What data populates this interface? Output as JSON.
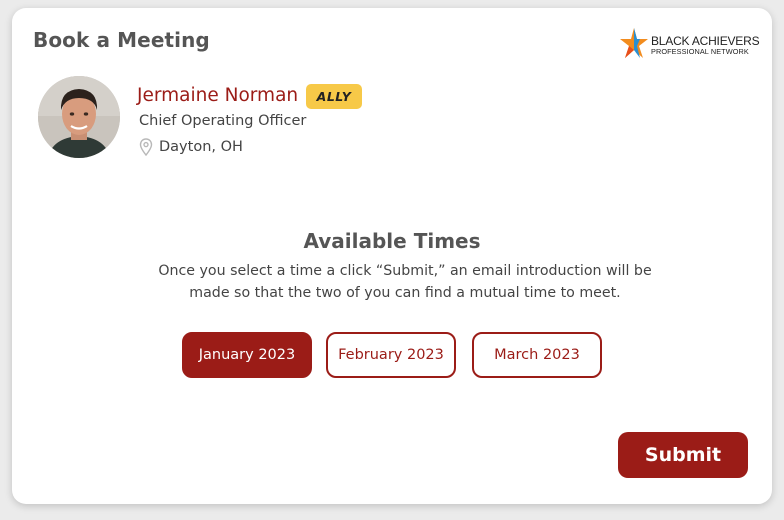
{
  "header": {
    "title": "Book a Meeting",
    "logo": {
      "line1": "BLACK ACHIEVERS",
      "line2": "PROFESSIONAL NETWORK"
    }
  },
  "profile": {
    "name": "Jermaine Norman",
    "badge": "ALLY",
    "role": "Chief Operating Officer",
    "location": "Dayton, OH"
  },
  "availability": {
    "title": "Available Times",
    "description": "Once you select a time a click “Submit,” an email introduction will be made so that the two of you can find a mutual time to meet.",
    "months": [
      {
        "label": "January 2023",
        "selected": true
      },
      {
        "label": "February 2023",
        "selected": false
      },
      {
        "label": "March 2023",
        "selected": false
      }
    ]
  },
  "actions": {
    "submit_label": "Submit"
  },
  "colors": {
    "accent": "#9b1c17",
    "badge": "#f7c948",
    "text_muted": "#555555"
  }
}
